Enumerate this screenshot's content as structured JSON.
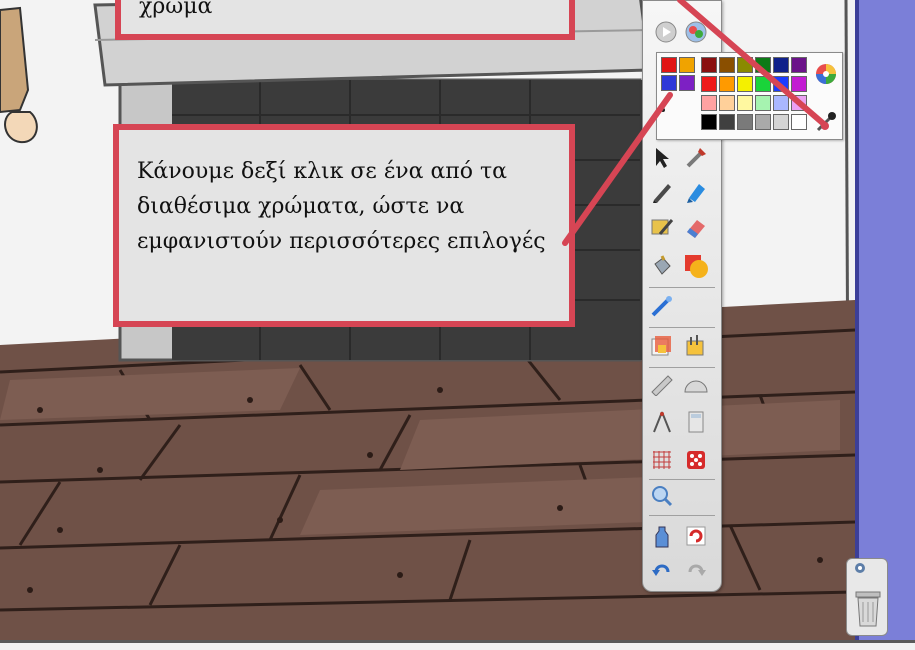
{
  "callouts": {
    "top_text": "χρώμα",
    "main_text": "Κάνουμε δεξί κλικ σε ένα από τα διαθέσιμα χρώματα, ώστε να εμφανιστούν περισσότερες επιλογές"
  },
  "colors": {
    "callout_border": "#d64554",
    "callout_fill": "#e4e4e4",
    "right_bar": "#7b7fd8",
    "wood_floor": "#6f5147",
    "wall": "#f3f3f3"
  },
  "palette": {
    "basic_colors": [
      "#e11515",
      "#f0a300",
      "#2e38d8",
      "#7d20c4"
    ],
    "grid_rows": [
      [
        "#8a1010",
        "#8a4f00",
        "#8a8a00",
        "#0c7a16",
        "#10208a",
        "#6b1389"
      ],
      [
        "#ee1a1a",
        "#ff9a00",
        "#f4f000",
        "#19d43a",
        "#1b3cff",
        "#c21bd2"
      ],
      [
        "#ffa2a2",
        "#ffd09a",
        "#fff8a0",
        "#a6f3b0",
        "#aab7ff",
        "#eba0f2"
      ],
      [
        "#000000",
        "#404040",
        "#7a7a7a",
        "#a9a9a9",
        "#d4d4d4",
        "#ffffff"
      ]
    ]
  },
  "icons": {
    "toolbar": [
      "select-arrow-icon",
      "tools-icon",
      "pen-icon",
      "highlighter-icon",
      "creative-pen-icon",
      "eraser-icon",
      "fill-bucket-icon",
      "shape-icon",
      "magic-pen-icon",
      "gallery-icon",
      "media-icon",
      "ruler-icon",
      "protractor-icon",
      "compass-icon",
      "calculator-icon",
      "grid-icon",
      "dice-icon",
      "spotlight-icon",
      "clear-page-icon",
      "refresh-icon",
      "undo-icon",
      "redo-icon"
    ],
    "palette_extra": [
      "color-wheel-icon",
      "eyedropper-icon"
    ],
    "trash": "trash-can-icon"
  }
}
